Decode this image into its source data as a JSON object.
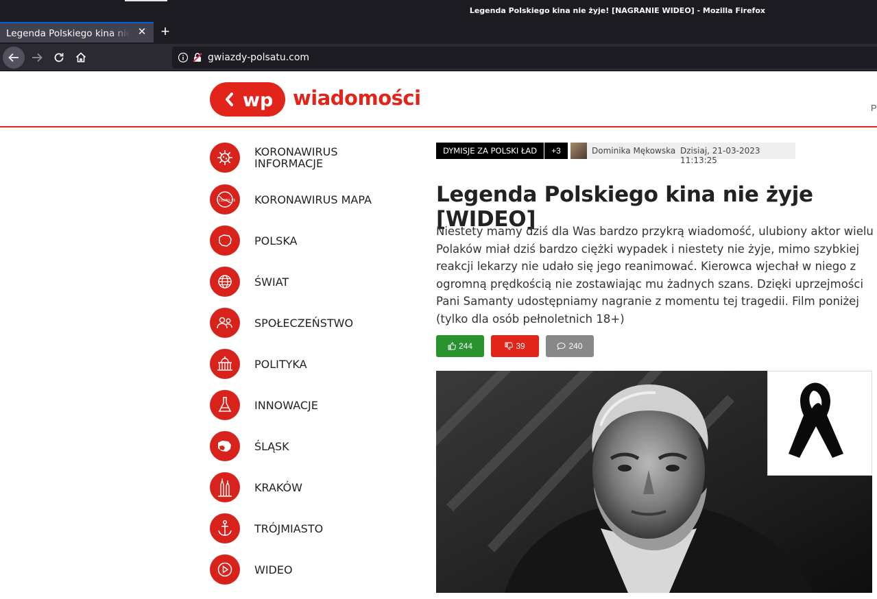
{
  "browser": {
    "window_title": "Legenda Polskiego kina nie żyje! [NAGRANIE WIDEO] - Mozilla Firefox",
    "tab_title": "Legenda Polskiego kina nie żyje! [NAGRANIE WIDEO]",
    "url": "gwiazdy-polsatu.com",
    "new_tab_label": "+",
    "tab_close_label": "✕"
  },
  "header": {
    "logo_mark": "wp",
    "logo_text": "wiadomości",
    "right_cut_text": "P"
  },
  "sidebar": {
    "items": [
      {
        "label": "KORONAWIRUS INFORMACJE",
        "icon": "virus-icon"
      },
      {
        "label": "KORONAWIRUS MAPA",
        "icon": "covid-globe-icon"
      },
      {
        "label": "POLSKA",
        "icon": "poland-map-icon"
      },
      {
        "label": "ŚWIAT",
        "icon": "globe-icon"
      },
      {
        "label": "SPOŁECZEŃSTWO",
        "icon": "people-icon"
      },
      {
        "label": "POLITYKA",
        "icon": "parliament-icon"
      },
      {
        "label": "INNOWACJE",
        "icon": "flask-icon"
      },
      {
        "label": "ŚLĄSK",
        "icon": "silesia-map-icon"
      },
      {
        "label": "KRAKÓW",
        "icon": "church-icon"
      },
      {
        "label": "TRÓJMIASTO",
        "icon": "anchor-icon"
      },
      {
        "label": "WIDEO",
        "icon": "play-icon"
      }
    ]
  },
  "article": {
    "tag": "DYMISJE ZA POLSKI ŁAD",
    "more_tags": "+3",
    "author": "Dominika Mękowska",
    "date": "Dzisiaj, 21-03-2023 11:13:25",
    "headline": "Legenda Polskiego kina nie żyje [WIDEO]",
    "lead": "Niestety mamy dziś dla Was bardzo przykrą wiadomość, ulubiony aktor wielu Polaków miał dziś bardzo ciężki wypadek i niestety nie żyje, mimo szybkiej reakcji lekarzy nie udało się jego reanimować. Kierowca wjechał w niego z ogromną prędkością nie zostawiając mu żadnych szans. Dzięki uprzejmości Pani Samanty udostępniamy nagranie z momentu tej tragedii. Film poniżej (tylko dla osób pełnoletnich 18+)",
    "reactions": {
      "likes": "244",
      "dislikes": "39",
      "comments": "240"
    }
  },
  "colors": {
    "brand_red": "#e1251b",
    "like_green": "#28932f",
    "comment_gray": "#888888",
    "chrome_dark": "#1c1b22"
  }
}
